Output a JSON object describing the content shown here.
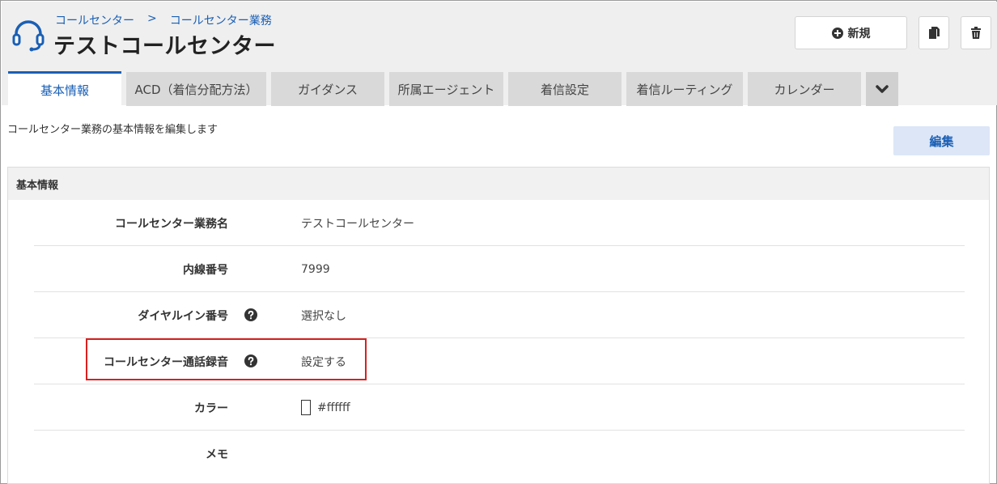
{
  "breadcrumb": {
    "items": [
      "コールセンター",
      "コールセンター業務"
    ],
    "separator": ">"
  },
  "page_title": "テストコールセンター",
  "toolbar": {
    "new_label": "新規",
    "new_icon": "plus-circle-icon",
    "copy_icon": "copy-icon",
    "delete_icon": "trash-icon"
  },
  "tabs": [
    {
      "label": "基本情報",
      "active": true
    },
    {
      "label": "ACD（着信分配方法）",
      "active": false
    },
    {
      "label": "ガイダンス",
      "active": false
    },
    {
      "label": "所属エージェント",
      "active": false
    },
    {
      "label": "着信設定",
      "active": false
    },
    {
      "label": "着信ルーティング",
      "active": false
    },
    {
      "label": "カレンダー",
      "active": false
    }
  ],
  "description": "コールセンター業務の基本情報を編集します",
  "edit_label": "編集",
  "panel": {
    "title": "基本情報",
    "rows": [
      {
        "label": "コールセンター業務名",
        "value": "テストコールセンター",
        "help": false
      },
      {
        "label": "内線番号",
        "value": "7999",
        "help": false
      },
      {
        "label": "ダイヤルイン番号",
        "value": "選択なし",
        "help": true
      },
      {
        "label": "コールセンター通話録音",
        "value": "設定する",
        "help": true
      },
      {
        "label": "カラー",
        "value": "#ffffff",
        "help": false
      },
      {
        "label": "メモ",
        "value": "",
        "help": false
      }
    ]
  },
  "colors": {
    "accent": "#1a5fb4",
    "highlight_border": "#d9201f",
    "tab_inactive": "#d9d9d9",
    "edit_button_bg": "#dce6f7",
    "swatch_color": "#ffffff"
  }
}
